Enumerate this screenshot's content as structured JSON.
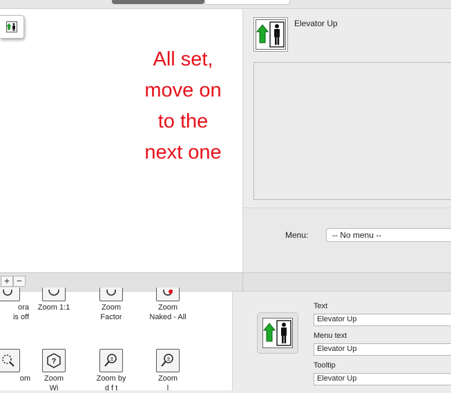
{
  "canvas": {
    "message_lines": [
      "All set,",
      "move on",
      "to the",
      "next one"
    ]
  },
  "inspector": {
    "item_title": "Elevator Up",
    "menu_label": "Menu:",
    "menu_value": "-- No menu --"
  },
  "bottom_bar": {
    "add_label": "+",
    "remove_label": "−"
  },
  "library": {
    "items": [
      {
        "label": "ora\nis off",
        "icon": "magnifier-icon"
      },
      {
        "label": "Zoom 1:1",
        "icon": "zoom-1-1-icon"
      },
      {
        "label": "Zoom\nFactor",
        "icon": "zoom-factor-icon"
      },
      {
        "label": "Zoom\nNaked - All",
        "icon": "zoom-naked-icon"
      },
      {
        "label": "om\n",
        "icon": "zoom-dotted-icon"
      },
      {
        "label": "Zoom\nWi",
        "icon": "zoom-window-icon"
      },
      {
        "label": "Zoom by\nd f t",
        "icon": "zoom-by-icon"
      },
      {
        "label": "Zoom\nl",
        "icon": "zoom-plusminus-icon"
      }
    ]
  },
  "details": {
    "text_label": "Text",
    "text_value": "Elevator Up",
    "menu_text_label": "Menu text",
    "menu_text_value": "Elevator Up",
    "tooltip_label": "Tooltip",
    "tooltip_value": "Elevator Up"
  },
  "colors": {
    "message": "#e8101a",
    "arrow_green": "#1faa2a"
  }
}
